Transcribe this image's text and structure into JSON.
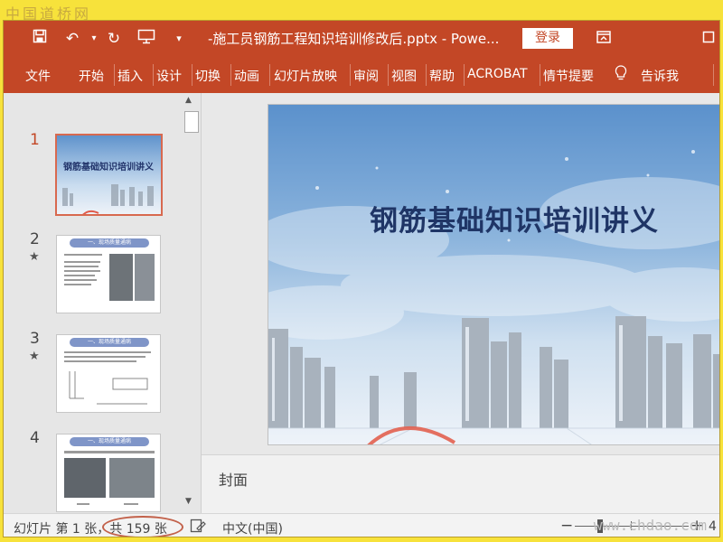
{
  "watermarks": {
    "top": "中国道桥网",
    "bottom": "www.chdao.com"
  },
  "titlebar": {
    "title": "-施工员钢筋工程知识培训修改后.pptx  -  Powe...",
    "login": "登录",
    "icons": [
      "save-icon",
      "undo-icon",
      "redo-icon",
      "present-from-start-icon",
      "customize-dropdown-icon",
      "ribbon-display-options-icon",
      "maximize-icon"
    ]
  },
  "ribbon": {
    "tabs": [
      "文件",
      "开始",
      "插入",
      "设计",
      "切换",
      "动画",
      "幻灯片放映",
      "审阅",
      "视图",
      "帮助",
      "ACROBAT",
      "情节提要"
    ],
    "tell_me": "告诉我"
  },
  "slides": [
    {
      "number": "1",
      "title": "钢筋基础知识培训讲义",
      "selected": true
    },
    {
      "number": "2",
      "star": "★",
      "header": "一、现场质量通病"
    },
    {
      "number": "3",
      "star": "★",
      "header": "一、现场质量通病"
    },
    {
      "number": "4",
      "header": "一、现场质量通病"
    }
  ],
  "main_slide": {
    "title": "钢筋基础知识培训讲义"
  },
  "notes": {
    "label": "封面"
  },
  "statusbar": {
    "slide_info": "幻灯片 第 1 张，共 159 张",
    "language": "中文(中国)",
    "zoom_minus": "−",
    "zoom_plus": "+",
    "zoom_value": "4"
  },
  "colors": {
    "accent": "#c34726",
    "selection": "#d8694f",
    "slide_title": "#1f3566",
    "annotation": "#c2614a"
  }
}
